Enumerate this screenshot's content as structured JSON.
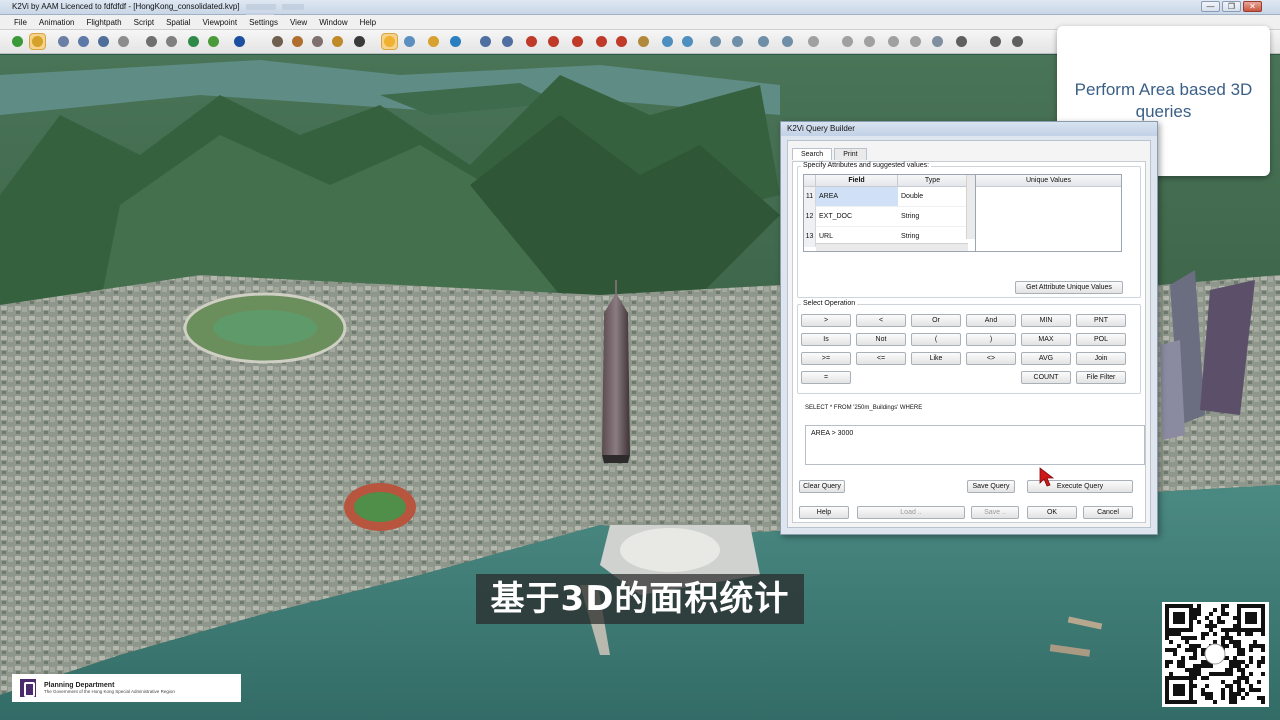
{
  "window": {
    "title": "K2Vi by AAM Licenced to fdfdfdf - [HongKong_consolidated.kvp]",
    "buttons": [
      "—",
      "❐",
      "✕"
    ]
  },
  "menu": [
    "File",
    "Animation",
    "Flightpath",
    "Script",
    "Spatial",
    "Viewpoint",
    "Settings",
    "View",
    "Window",
    "Help"
  ],
  "callout": {
    "text": "Perform Area based 3D queries"
  },
  "dialog": {
    "title": "K2Vi Query Builder",
    "tabs": [
      "Search",
      "Print"
    ],
    "attributes_group": "Specify Attributes and suggested values:",
    "columns": {
      "field": "Field",
      "type": "Type",
      "unique": "Unique Values"
    },
    "rows": [
      {
        "num": "11",
        "field": "AREA",
        "type": "Double"
      },
      {
        "num": "12",
        "field": "EXT_DOC",
        "type": "String"
      },
      {
        "num": "13",
        "field": "URL",
        "type": "String"
      }
    ],
    "get_unique_button": "Get Attribute Unique Values",
    "operation_group": "Select Operation",
    "operations": [
      [
        ">",
        "<",
        "Or",
        "And",
        "MIN",
        "PNT"
      ],
      [
        "Is",
        "Not",
        "(",
        ")",
        "MAX",
        "POL"
      ],
      [
        ">=",
        "<=",
        "Like",
        "<>",
        "AVG",
        "Join"
      ]
    ],
    "op_eq": "=",
    "op_count": "COUNT",
    "op_filefilter": "File Filter",
    "sql_prefix": "SELECT * FROM '250m_Buildings' WHERE",
    "sql_text": "AREA  > 3000",
    "clear_query": "Clear Query",
    "save_query": "Save Query",
    "execute_query": "Execute Query",
    "help": "Help",
    "load": "Load ..",
    "save": "Save ..",
    "ok": "OK",
    "cancel": "Cancel"
  },
  "subtitle": "基于3D的面积统计",
  "footer": {
    "org": "Planning Department",
    "org_sub": "The Government of the Hong Kong Special Administrative Region"
  },
  "colors": {
    "accent_text": "#3a5f86",
    "sea": "#3f7f78",
    "hills": "#2f5a3d",
    "city": "#9a9a8e"
  }
}
